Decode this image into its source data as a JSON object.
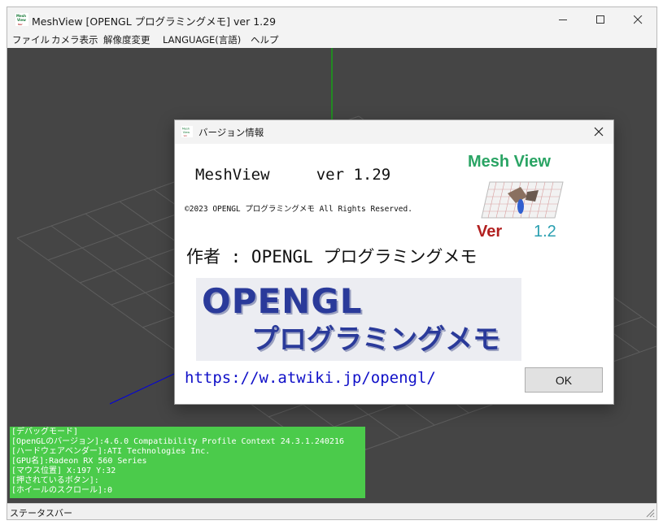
{
  "window": {
    "title": "MeshView [OPENGL プログラミングメモ] ver 1.29",
    "icon_name": "meshview-app-icon",
    "icon_text": "Mesh View"
  },
  "title_buttons": {
    "minimize": "─",
    "maximize": "☐",
    "close": "✕"
  },
  "menu": [
    {
      "label": "ファイル"
    },
    {
      "label": "カメラ表示"
    },
    {
      "label": "解像度変更"
    },
    {
      "label": "LANGUAGE(言語)"
    },
    {
      "label": "ヘルプ"
    }
  ],
  "debug_panel": {
    "lines": [
      "[デバッグモード]",
      "[OpenGLのバージョン]:4.6.0 Compatibility Profile Context 24.3.1.240216",
      "[ハードウェアベンダー]:ATI Technologies Inc.",
      "[GPU名]:Radeon RX 560 Series",
      "[マウス位置] X:197 Y:32",
      "[押されているボタン]:",
      "[ホイールのスクロール]:0"
    ]
  },
  "statusbar": {
    "text": "ステータスバー"
  },
  "dialog": {
    "title": "バージョン情報",
    "close": "✕",
    "app_name": "MeshView",
    "version": "ver 1.29",
    "copyright": "©2023 OPENGL プログラミングメモ All Rights Reserved.",
    "author": "作者 : OPENGL プログラミングメモ",
    "logo": {
      "title": "Mesh View",
      "ver_label": "Ver",
      "ver_number": "1.2"
    },
    "banner": {
      "line1": "OPENGL",
      "line2": "プログラミングメモ"
    },
    "url": "https://w.atwiki.jp/opengl/",
    "ok_label": "OK"
  },
  "colors": {
    "viewport_bg": "#454545",
    "grid": "#5c5c5c",
    "y_axis": "#00d000",
    "z_axis": "#0000e0",
    "debug_bg": "#4bcb4b",
    "link": "#1010c8"
  }
}
